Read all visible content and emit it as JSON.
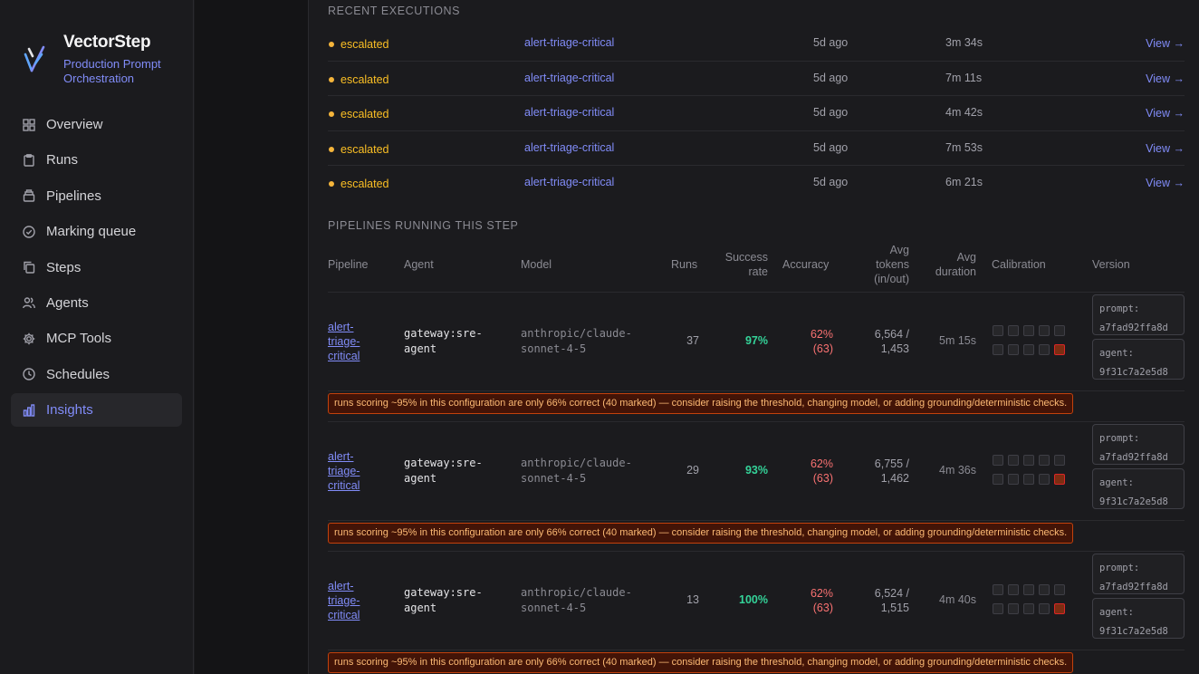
{
  "brand": {
    "name": "VectorStep",
    "subtitle": "Production Prompt Orchestration"
  },
  "nav": [
    {
      "label": "Overview",
      "icon": "grid-icon"
    },
    {
      "label": "Runs",
      "icon": "clipboard-icon"
    },
    {
      "label": "Pipelines",
      "icon": "stack-icon"
    },
    {
      "label": "Marking queue",
      "icon": "check-circle-icon"
    },
    {
      "label": "Steps",
      "icon": "copy-icon"
    },
    {
      "label": "Agents",
      "icon": "users-icon"
    },
    {
      "label": "MCP Tools",
      "icon": "gear-icon"
    },
    {
      "label": "Schedules",
      "icon": "clock-icon"
    },
    {
      "label": "Insights",
      "icon": "bar-chart-icon",
      "active": true
    }
  ],
  "recent": {
    "title": "RECENT EXECUTIONS",
    "rows": [
      {
        "status": "escalated",
        "pipeline": "alert-triage-critical",
        "when": "5d ago",
        "duration": "3m 34s",
        "action": "View →"
      },
      {
        "status": "escalated",
        "pipeline": "alert-triage-critical",
        "when": "5d ago",
        "duration": "7m 11s",
        "action": "View →"
      },
      {
        "status": "escalated",
        "pipeline": "alert-triage-critical",
        "when": "5d ago",
        "duration": "4m 42s",
        "action": "View →"
      },
      {
        "status": "escalated",
        "pipeline": "alert-triage-critical",
        "when": "5d ago",
        "duration": "7m 53s",
        "action": "View →"
      },
      {
        "status": "escalated",
        "pipeline": "alert-triage-critical",
        "when": "5d ago",
        "duration": "6m 21s",
        "action": "View →"
      }
    ]
  },
  "pipelines": {
    "title": "PIPELINES RUNNING THIS STEP",
    "headers": {
      "pipeline": "Pipeline",
      "agent": "Agent",
      "model": "Model",
      "runs": "Runs",
      "success": "Success rate",
      "accuracy": "Accuracy",
      "tokens": "Avg tokens (in/out)",
      "duration": "Avg duration",
      "calibration": "Calibration",
      "version": "Version"
    },
    "rows": [
      {
        "pipeline": "alert-triage-critical",
        "agent": "gateway:sre-agent",
        "model": "anthropic/claude-sonnet-4-5",
        "runs": "37",
        "success": "97%",
        "accuracy": "62% (63)",
        "tokens": "6,564 / 1,453",
        "duration": "5m 15s",
        "prompt": "prompt: a7fad92ffa8d",
        "agent_ver": "agent: 9f31c7a2e5d8",
        "warning": "runs scoring ~95% in this configuration are only 66% correct (40 marked) — consider raising the threshold, changing model, or adding grounding/deterministic checks."
      },
      {
        "pipeline": "alert-triage-critical",
        "agent": "gateway:sre-agent",
        "model": "anthropic/claude-sonnet-4-5",
        "runs": "29",
        "success": "93%",
        "accuracy": "62% (63)",
        "tokens": "6,755 / 1,462",
        "duration": "4m 36s",
        "prompt": "prompt: a7fad92ffa8d",
        "agent_ver": "agent: 9f31c7a2e5d8",
        "warning": "runs scoring ~95% in this configuration are only 66% correct (40 marked) — consider raising the threshold, changing model, or adding grounding/deterministic checks."
      },
      {
        "pipeline": "alert-triage-critical",
        "agent": "gateway:sre-agent",
        "model": "anthropic/claude-sonnet-4-5",
        "runs": "13",
        "success": "100%",
        "accuracy": "62% (63)",
        "tokens": "6,524 / 1,515",
        "duration": "4m 40s",
        "prompt": "prompt: a7fad92ffa8d",
        "agent_ver": "agent: 9f31c7a2e5d8",
        "warning": "runs scoring ~95% in this configuration are only 66% correct (40 marked) — consider raising the threshold, changing model, or adding grounding/deterministic checks."
      }
    ]
  },
  "colors": {
    "accent": "#818cf8",
    "escalated": "#fbbf24",
    "success": "#34d399",
    "accuracy": "#f87171",
    "warning_border": "#c2410c"
  }
}
